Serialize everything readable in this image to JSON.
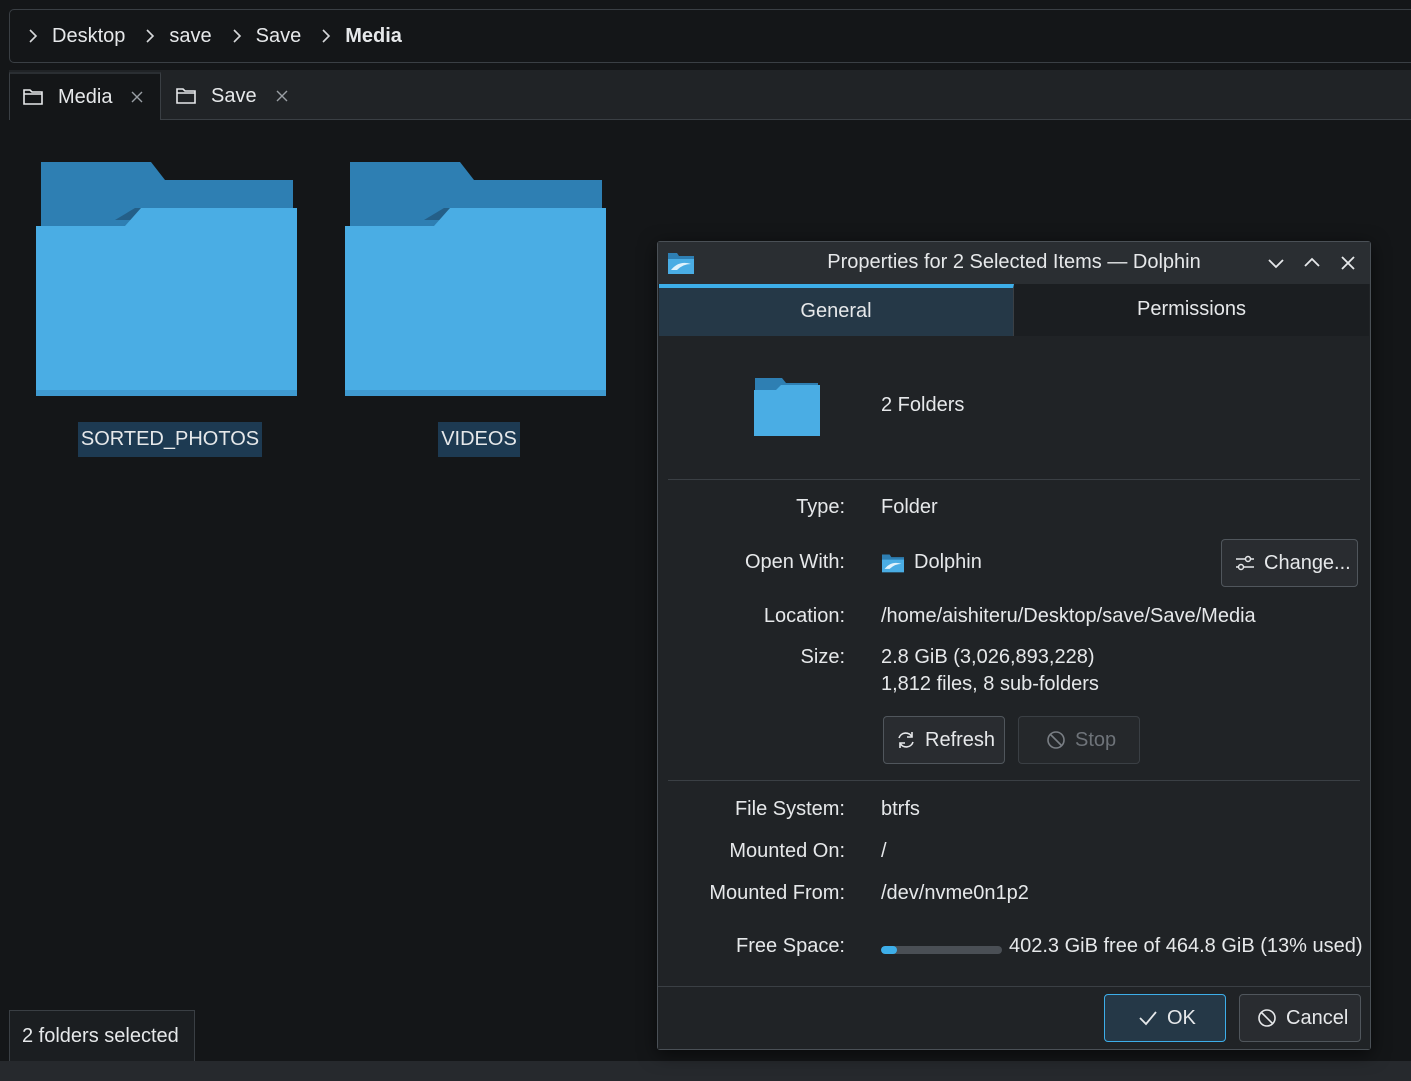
{
  "breadcrumb": {
    "items": [
      {
        "label": "Desktop"
      },
      {
        "label": "save"
      },
      {
        "label": "Save"
      },
      {
        "label": "Media"
      }
    ]
  },
  "tabs": [
    {
      "label": "Media",
      "active": true
    },
    {
      "label": "Save",
      "active": false
    }
  ],
  "folders": [
    {
      "name": "SORTED_PHOTOS"
    },
    {
      "name": "VIDEOS"
    }
  ],
  "status": {
    "text": "2 folders selected"
  },
  "dialog": {
    "title": "Properties for 2 Selected Items — Dolphin",
    "tabs": {
      "general": "General",
      "permissions": "Permissions"
    },
    "summary": "2 Folders",
    "type_label": "Type:",
    "type_value": "Folder",
    "open_with_label": "Open With:",
    "open_with_value": "Dolphin",
    "change_button": "Change...",
    "location_label": "Location:",
    "location_value": "/home/aishiteru/Desktop/save/Save/Media",
    "size_label": "Size:",
    "size_value": "2.8 GiB (3,026,893,228)",
    "size_detail": "1,812 files, 8 sub-folders",
    "refresh_button": "Refresh",
    "stop_button": "Stop",
    "fs_label": "File System:",
    "fs_value": "btrfs",
    "mounted_on_label": "Mounted On:",
    "mounted_on_value": "/",
    "mounted_from_label": "Mounted From:",
    "mounted_from_value": "/dev/nvme0n1p2",
    "free_space_label": "Free Space:",
    "free_space_value": "402.3 GiB free of 464.8 GiB (13% used)",
    "free_space_used_fraction": 0.13,
    "ok_button": "OK",
    "cancel_button": "Cancel"
  },
  "colors": {
    "accent": "#3daee9",
    "folder_front": "#4aade4",
    "folder_back": "#2e7fb3"
  }
}
